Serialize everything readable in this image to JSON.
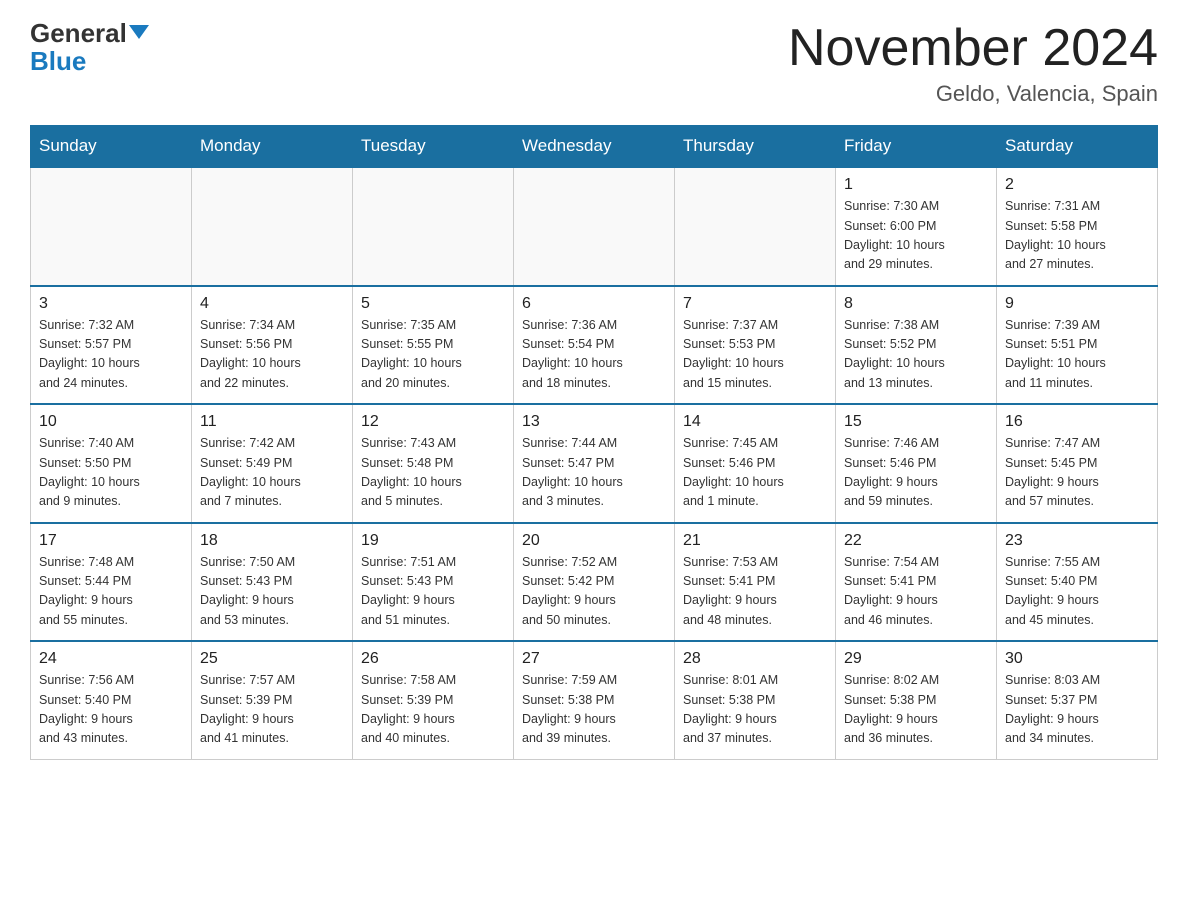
{
  "header": {
    "logo_line1": "General",
    "logo_line2": "Blue",
    "title": "November 2024",
    "subtitle": "Geldo, Valencia, Spain"
  },
  "days_of_week": [
    "Sunday",
    "Monday",
    "Tuesday",
    "Wednesday",
    "Thursday",
    "Friday",
    "Saturday"
  ],
  "weeks": [
    [
      {
        "day": "",
        "info": ""
      },
      {
        "day": "",
        "info": ""
      },
      {
        "day": "",
        "info": ""
      },
      {
        "day": "",
        "info": ""
      },
      {
        "day": "",
        "info": ""
      },
      {
        "day": "1",
        "info": "Sunrise: 7:30 AM\nSunset: 6:00 PM\nDaylight: 10 hours\nand 29 minutes."
      },
      {
        "day": "2",
        "info": "Sunrise: 7:31 AM\nSunset: 5:58 PM\nDaylight: 10 hours\nand 27 minutes."
      }
    ],
    [
      {
        "day": "3",
        "info": "Sunrise: 7:32 AM\nSunset: 5:57 PM\nDaylight: 10 hours\nand 24 minutes."
      },
      {
        "day": "4",
        "info": "Sunrise: 7:34 AM\nSunset: 5:56 PM\nDaylight: 10 hours\nand 22 minutes."
      },
      {
        "day": "5",
        "info": "Sunrise: 7:35 AM\nSunset: 5:55 PM\nDaylight: 10 hours\nand 20 minutes."
      },
      {
        "day": "6",
        "info": "Sunrise: 7:36 AM\nSunset: 5:54 PM\nDaylight: 10 hours\nand 18 minutes."
      },
      {
        "day": "7",
        "info": "Sunrise: 7:37 AM\nSunset: 5:53 PM\nDaylight: 10 hours\nand 15 minutes."
      },
      {
        "day": "8",
        "info": "Sunrise: 7:38 AM\nSunset: 5:52 PM\nDaylight: 10 hours\nand 13 minutes."
      },
      {
        "day": "9",
        "info": "Sunrise: 7:39 AM\nSunset: 5:51 PM\nDaylight: 10 hours\nand 11 minutes."
      }
    ],
    [
      {
        "day": "10",
        "info": "Sunrise: 7:40 AM\nSunset: 5:50 PM\nDaylight: 10 hours\nand 9 minutes."
      },
      {
        "day": "11",
        "info": "Sunrise: 7:42 AM\nSunset: 5:49 PM\nDaylight: 10 hours\nand 7 minutes."
      },
      {
        "day": "12",
        "info": "Sunrise: 7:43 AM\nSunset: 5:48 PM\nDaylight: 10 hours\nand 5 minutes."
      },
      {
        "day": "13",
        "info": "Sunrise: 7:44 AM\nSunset: 5:47 PM\nDaylight: 10 hours\nand 3 minutes."
      },
      {
        "day": "14",
        "info": "Sunrise: 7:45 AM\nSunset: 5:46 PM\nDaylight: 10 hours\nand 1 minute."
      },
      {
        "day": "15",
        "info": "Sunrise: 7:46 AM\nSunset: 5:46 PM\nDaylight: 9 hours\nand 59 minutes."
      },
      {
        "day": "16",
        "info": "Sunrise: 7:47 AM\nSunset: 5:45 PM\nDaylight: 9 hours\nand 57 minutes."
      }
    ],
    [
      {
        "day": "17",
        "info": "Sunrise: 7:48 AM\nSunset: 5:44 PM\nDaylight: 9 hours\nand 55 minutes."
      },
      {
        "day": "18",
        "info": "Sunrise: 7:50 AM\nSunset: 5:43 PM\nDaylight: 9 hours\nand 53 minutes."
      },
      {
        "day": "19",
        "info": "Sunrise: 7:51 AM\nSunset: 5:43 PM\nDaylight: 9 hours\nand 51 minutes."
      },
      {
        "day": "20",
        "info": "Sunrise: 7:52 AM\nSunset: 5:42 PM\nDaylight: 9 hours\nand 50 minutes."
      },
      {
        "day": "21",
        "info": "Sunrise: 7:53 AM\nSunset: 5:41 PM\nDaylight: 9 hours\nand 48 minutes."
      },
      {
        "day": "22",
        "info": "Sunrise: 7:54 AM\nSunset: 5:41 PM\nDaylight: 9 hours\nand 46 minutes."
      },
      {
        "day": "23",
        "info": "Sunrise: 7:55 AM\nSunset: 5:40 PM\nDaylight: 9 hours\nand 45 minutes."
      }
    ],
    [
      {
        "day": "24",
        "info": "Sunrise: 7:56 AM\nSunset: 5:40 PM\nDaylight: 9 hours\nand 43 minutes."
      },
      {
        "day": "25",
        "info": "Sunrise: 7:57 AM\nSunset: 5:39 PM\nDaylight: 9 hours\nand 41 minutes."
      },
      {
        "day": "26",
        "info": "Sunrise: 7:58 AM\nSunset: 5:39 PM\nDaylight: 9 hours\nand 40 minutes."
      },
      {
        "day": "27",
        "info": "Sunrise: 7:59 AM\nSunset: 5:38 PM\nDaylight: 9 hours\nand 39 minutes."
      },
      {
        "day": "28",
        "info": "Sunrise: 8:01 AM\nSunset: 5:38 PM\nDaylight: 9 hours\nand 37 minutes."
      },
      {
        "day": "29",
        "info": "Sunrise: 8:02 AM\nSunset: 5:38 PM\nDaylight: 9 hours\nand 36 minutes."
      },
      {
        "day": "30",
        "info": "Sunrise: 8:03 AM\nSunset: 5:37 PM\nDaylight: 9 hours\nand 34 minutes."
      }
    ]
  ]
}
